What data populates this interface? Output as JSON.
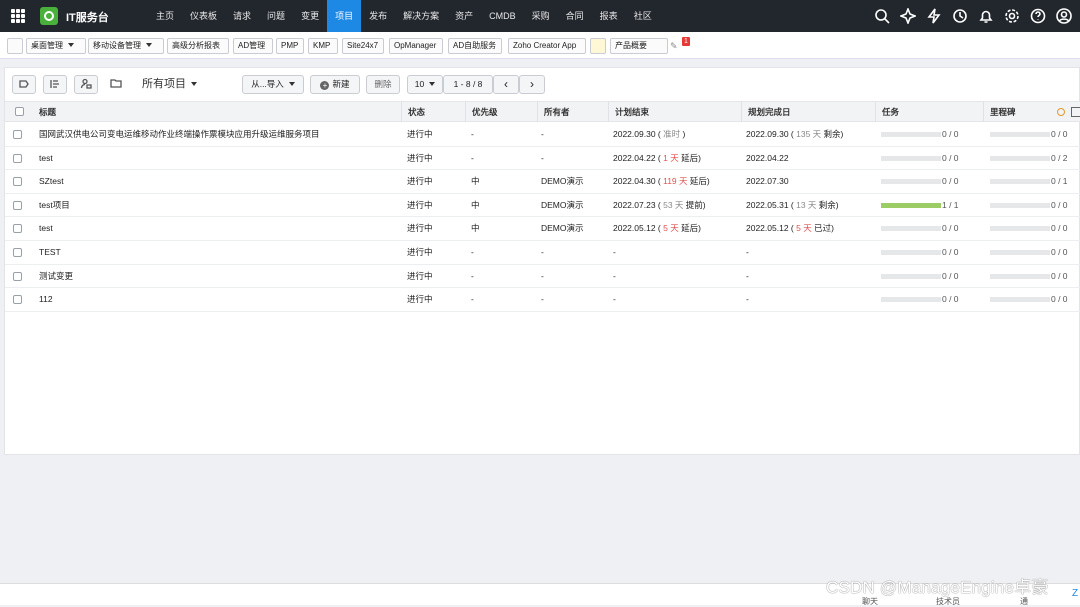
{
  "app": {
    "title": "IT服务台"
  },
  "nav": [
    "主页",
    "仪表板",
    "请求",
    "问题",
    "变更",
    "项目",
    "发布",
    "解决方案",
    "资产",
    "CMDB",
    "采购",
    "合同",
    "报表",
    "社区"
  ],
  "nav_active": "项目",
  "top_icons": [
    "search-icon",
    "sparkle-icon",
    "lightning-icon",
    "history-icon",
    "bell-icon",
    "gear-icon",
    "help-icon",
    "user-icon"
  ],
  "toolbar": {
    "items": [
      "桌面管理",
      "移动设备管理",
      "高级分析报表",
      "AD管理",
      "PMP",
      "KMP",
      "Site24x7",
      "OpManager",
      "AD自助服务",
      "Zoho Creator App",
      "产品概要"
    ],
    "badge": "1"
  },
  "list": {
    "view": "所有项目",
    "import_label": "从...导入",
    "new_label": "新建",
    "delete_label": "删除",
    "page_size": "10",
    "range": "1 - 8 / 8"
  },
  "columns": [
    "标题",
    "状态",
    "优先级",
    "所有者",
    "计划结束",
    "规划完成日",
    "任务",
    "里程碑"
  ],
  "rows": [
    {
      "title": "国网武汉供电公司变电运维移动作业终端操作票模块应用升级运维服务项目",
      "status": "进行中",
      "priority": "-",
      "owner": "-",
      "plan_end": "2022.09.30",
      "plan_note_pre": " ( ",
      "plan_note_hl": "准时",
      "plan_note_post": " )",
      "plan_hl": "gray",
      "done": "2022.09.30",
      "done_pre": " ( ",
      "done_hl": "135 天",
      "done_post": " 剩余)",
      "done_hlc": "gray",
      "task": "0 / 0",
      "task_pct": 0,
      "ms": "0 / 0",
      "ms_pct": 0
    },
    {
      "title": "test",
      "status": "进行中",
      "priority": "-",
      "owner": "-",
      "plan_end": "2022.04.22",
      "plan_note_pre": " ( ",
      "plan_note_hl": "1 天",
      "plan_note_post": " 延后)",
      "plan_hl": "red",
      "done": "2022.04.22",
      "done_pre": "",
      "done_hl": "",
      "done_post": "",
      "done_hlc": "gray",
      "task": "0 / 0",
      "task_pct": 0,
      "ms": "0 / 2",
      "ms_pct": 0
    },
    {
      "title": "SZtest",
      "status": "进行中",
      "priority": "中",
      "owner": "DEMO演示",
      "plan_end": "2022.04.30",
      "plan_note_pre": " ( ",
      "plan_note_hl": "119 天",
      "plan_note_post": " 延后)",
      "plan_hl": "red",
      "done": "2022.07.30",
      "done_pre": "",
      "done_hl": "",
      "done_post": "",
      "done_hlc": "gray",
      "task": "0 / 0",
      "task_pct": 0,
      "ms": "0 / 1",
      "ms_pct": 0
    },
    {
      "title": "test项目",
      "status": "进行中",
      "priority": "中",
      "owner": "DEMO演示",
      "plan_end": "2022.07.23",
      "plan_note_pre": " ( ",
      "plan_note_hl": "53 天",
      "plan_note_post": " 提前)",
      "plan_hl": "gray",
      "done": "2022.05.31",
      "done_pre": " ( ",
      "done_hl": "13 天",
      "done_post": " 剩余)",
      "done_hlc": "gray",
      "task": "1 / 1",
      "task_pct": 1,
      "ms": "0 / 0",
      "ms_pct": 0
    },
    {
      "title": "test",
      "status": "进行中",
      "priority": "中",
      "owner": "DEMO演示",
      "plan_end": "2022.05.12",
      "plan_note_pre": " ( ",
      "plan_note_hl": "5 天",
      "plan_note_post": " 延后)",
      "plan_hl": "red",
      "done": "2022.05.12",
      "done_pre": " ( ",
      "done_hl": "5 天",
      "done_post": " 已过)",
      "done_hlc": "red",
      "task": "0 / 0",
      "task_pct": 0,
      "ms": "0 / 0",
      "ms_pct": 0
    },
    {
      "title": "TEST",
      "status": "进行中",
      "priority": "-",
      "owner": "-",
      "plan_end": "-",
      "plan_note_pre": "",
      "plan_note_hl": "",
      "plan_note_post": "",
      "plan_hl": "gray",
      "done": "-",
      "done_pre": "",
      "done_hl": "",
      "done_post": "",
      "done_hlc": "gray",
      "task": "0 / 0",
      "task_pct": 0,
      "ms": "0 / 0",
      "ms_pct": 0
    },
    {
      "title": "测试变更",
      "status": "进行中",
      "priority": "-",
      "owner": "-",
      "plan_end": "-",
      "plan_note_pre": "",
      "plan_note_hl": "",
      "plan_note_post": "",
      "plan_hl": "gray",
      "done": "-",
      "done_pre": "",
      "done_hl": "",
      "done_post": "",
      "done_hlc": "gray",
      "task": "0 / 0",
      "task_pct": 0,
      "ms": "0 / 0",
      "ms_pct": 0
    },
    {
      "title": "112",
      "status": "进行中",
      "priority": "-",
      "owner": "-",
      "plan_end": "-",
      "plan_note_pre": "",
      "plan_note_hl": "",
      "plan_note_post": "",
      "plan_hl": "gray",
      "done": "-",
      "done_pre": "",
      "done_hl": "",
      "done_post": "",
      "done_hlc": "gray",
      "task": "0 / 0",
      "task_pct": 0,
      "ms": "0 / 0",
      "ms_pct": 0
    }
  ],
  "bottom": {
    "labels": [
      "聊天",
      "技术员",
      "通"
    ],
    "extra": "Z"
  },
  "watermark": "CSDN @ManageEngine卓豪",
  "colors": {
    "topbar": "#22262d",
    "accent": "#1e88e5",
    "progress": "#9ccc65",
    "late": "#e25050"
  }
}
